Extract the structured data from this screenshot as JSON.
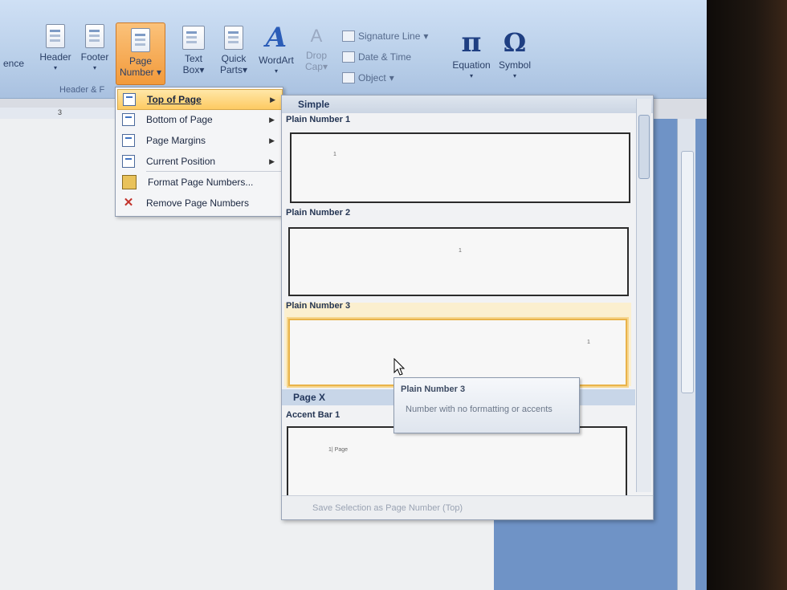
{
  "ribbon": {
    "buttons": [
      {
        "label": "ence"
      },
      {
        "label": "Header"
      },
      {
        "label": "Footer"
      },
      {
        "label": "Page Number",
        "line1": "Page",
        "line2": "Number"
      },
      {
        "label": "Text Box",
        "line1": "Text",
        "line2": "Box"
      },
      {
        "label": "Quick Parts",
        "line1": "Quick",
        "line2": "Parts"
      },
      {
        "label": "WordArt"
      },
      {
        "label": "Drop Cap",
        "line1": "Drop",
        "line2": "Cap"
      },
      {
        "label": "Equation"
      },
      {
        "label": "Symbol"
      }
    ],
    "small_items": [
      "Signature Line",
      "Date & Time",
      "Object"
    ],
    "group_label": "Header & F",
    "icons": {
      "equation": "π",
      "symbol": "Ω",
      "wordart": "A"
    }
  },
  "ruler": {
    "mark": "3"
  },
  "menu": {
    "items": [
      {
        "label": "Top of Page",
        "icon": "page-top-icon",
        "submenu": true,
        "selected": true
      },
      {
        "label": "Bottom of Page",
        "icon": "page-bottom-icon",
        "submenu": true
      },
      {
        "label": "Page Margins",
        "icon": "page-margins-icon",
        "submenu": true
      },
      {
        "label": "Current Position",
        "icon": "current-position-icon",
        "submenu": true
      },
      {
        "label": "Format Page Numbers...",
        "icon": "format-numbers-icon"
      },
      {
        "label": "Remove Page Numbers",
        "icon": "remove-numbers-icon"
      }
    ]
  },
  "gallery": {
    "header": "Simple",
    "items": [
      {
        "label": "Plain Number 1"
      },
      {
        "label": "Plain Number 2"
      },
      {
        "label": "Plain Number 3",
        "highlighted": true
      }
    ],
    "section2": "Page X",
    "item4": "Accent Bar 1",
    "footer": "Save Selection as Page Number (Top)"
  },
  "tooltip": {
    "title": "Plain Number 3",
    "description": "Number with no formatting or accents"
  },
  "colors": {
    "accent_orange": "#f29a3b",
    "menu_highlight": "#fdca62",
    "ribbon_blue": "#b9cfe9"
  }
}
